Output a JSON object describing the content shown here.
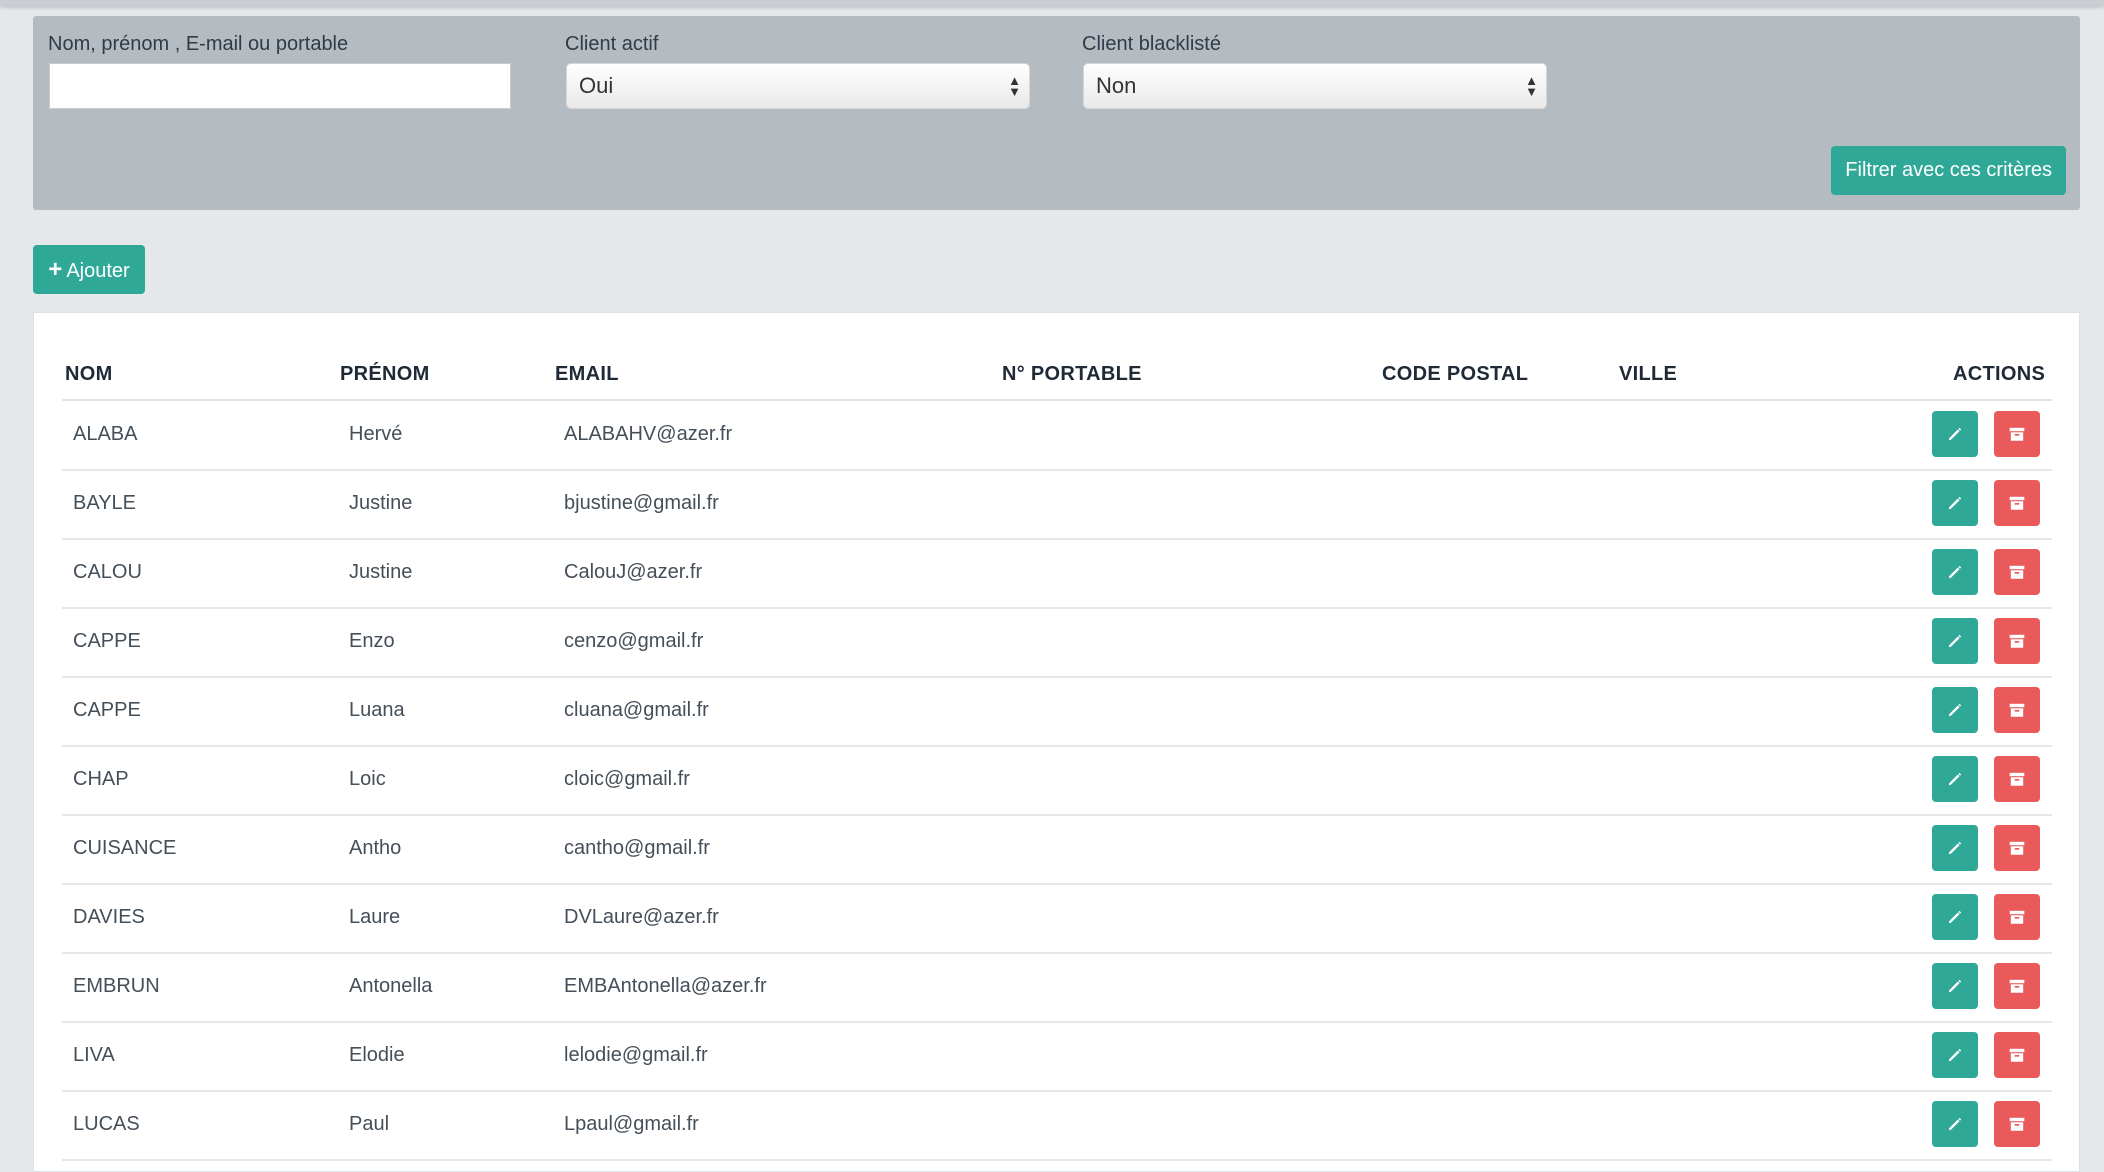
{
  "filters": {
    "search_label": "Nom, prénom , E-mail ou portable",
    "search_value": "",
    "active_label": "Client actif",
    "active_value": "Oui",
    "blacklist_label": "Client blacklisté",
    "blacklist_value": "Non",
    "submit_label": "Filtrer avec ces critères"
  },
  "add_button": {
    "label": "Ajouter"
  },
  "table": {
    "headers": [
      "NOM",
      "PRÉNOM",
      "EMAIL",
      "N° PORTABLE",
      "CODE POSTAL",
      "VILLE",
      "ACTIONS"
    ],
    "rows": [
      {
        "nom": "ALABA",
        "prenom": "Hervé",
        "email": "ALABAHV@azer.fr",
        "portable": "",
        "cp": "",
        "ville": ""
      },
      {
        "nom": "BAYLE",
        "prenom": "Justine",
        "email": "bjustine@gmail.fr",
        "portable": "",
        "cp": "",
        "ville": ""
      },
      {
        "nom": "CALOU",
        "prenom": "Justine",
        "email": "CalouJ@azer.fr",
        "portable": "",
        "cp": "",
        "ville": ""
      },
      {
        "nom": "CAPPE",
        "prenom": "Enzo",
        "email": "cenzo@gmail.fr",
        "portable": "",
        "cp": "",
        "ville": ""
      },
      {
        "nom": "CAPPE",
        "prenom": "Luana",
        "email": "cluana@gmail.fr",
        "portable": "",
        "cp": "",
        "ville": ""
      },
      {
        "nom": "CHAP",
        "prenom": "Loic",
        "email": "cloic@gmail.fr",
        "portable": "",
        "cp": "",
        "ville": ""
      },
      {
        "nom": "CUISANCE",
        "prenom": "Antho",
        "email": "cantho@gmail.fr",
        "portable": "",
        "cp": "",
        "ville": ""
      },
      {
        "nom": "DAVIES",
        "prenom": "Laure",
        "email": "DVLaure@azer.fr",
        "portable": "",
        "cp": "",
        "ville": ""
      },
      {
        "nom": "EMBRUN",
        "prenom": "Antonella",
        "email": "EMBAntonella@azer.fr",
        "portable": "",
        "cp": "",
        "ville": ""
      },
      {
        "nom": "LIVA",
        "prenom": "Elodie",
        "email": "lelodie@gmail.fr",
        "portable": "",
        "cp": "",
        "ville": ""
      },
      {
        "nom": "LUCAS",
        "prenom": "Paul",
        "email": "Lpaul@gmail.fr",
        "portable": "",
        "cp": "",
        "ville": ""
      }
    ]
  },
  "icons": {
    "edit": "pencil-icon",
    "delete": "archive-icon",
    "add": "plus-icon"
  },
  "colors": {
    "primary": "#2fa898",
    "danger": "#eb5a5a",
    "panel": "#b5bcc1"
  }
}
